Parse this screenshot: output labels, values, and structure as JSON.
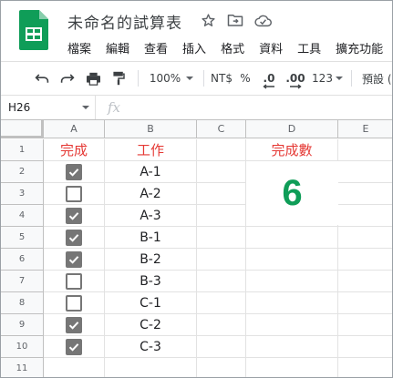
{
  "app": {
    "doc_title": "未命名的試算表",
    "icons": [
      "star-icon",
      "move-to-folder-icon",
      "cloud-status-icon"
    ],
    "menu": [
      "檔案",
      "編輯",
      "查看",
      "插入",
      "格式",
      "資料",
      "工具",
      "擴充功能"
    ]
  },
  "toolbar": {
    "zoom": "100%",
    "currency": "NT$",
    "percent": "%",
    "decimal_decrease": ".0",
    "decimal_increase": ".00",
    "more_formats": "123",
    "default_font": "預設 ("
  },
  "formula_bar": {
    "cell_ref": "H26",
    "fx_label": "fx"
  },
  "grid": {
    "columns": [
      "A",
      "B",
      "C",
      "D",
      "E"
    ],
    "row_numbers": [
      "1",
      "2",
      "3",
      "4",
      "5",
      "6",
      "7",
      "8",
      "9",
      "10",
      "11"
    ],
    "header_a": "完成",
    "header_b": "工作",
    "header_d": "完成數",
    "count_value": "6",
    "tasks": [
      "A-1",
      "A-2",
      "A-3",
      "B-1",
      "B-2",
      "B-3",
      "C-1",
      "C-2",
      "C-3"
    ],
    "checked": [
      true,
      false,
      true,
      true,
      true,
      false,
      false,
      true,
      true
    ]
  },
  "colors": {
    "header_red": "#e53935",
    "count_green": "#0f9d58",
    "checkbox_gray": "#767676",
    "sheets_green": "#0f9d58"
  }
}
